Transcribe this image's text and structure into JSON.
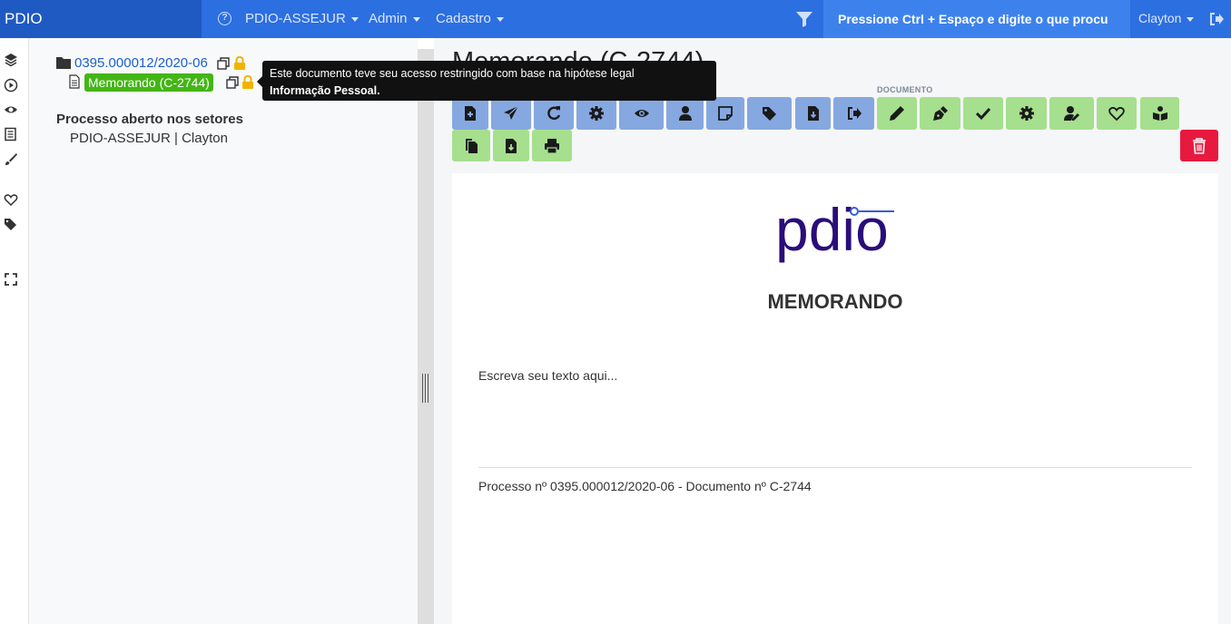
{
  "navbar": {
    "brand": "PDIO",
    "menus": [
      "PDIO-ASSEJUR",
      "Admin",
      "Cadastro"
    ],
    "search_placeholder": "Pressione Ctrl + Espaço e digite o que procu",
    "user": "Clayton"
  },
  "tree": {
    "process_number": "0395.000012/2020-06",
    "document_label": "Memorando (C-2744)",
    "section_title": "Processo aberto nos setores",
    "section_item": "PDIO-ASSEJUR | Clayton"
  },
  "tooltip": {
    "line1": "Este documento teve seu acesso restringido com base na hipótese legal",
    "line2": "Informação Pessoal."
  },
  "main": {
    "title": "Memorando (C-2744)",
    "group_label_document": "DOCUMENTO"
  },
  "document": {
    "logo_text": "pdio",
    "heading": "MEMORANDO",
    "body": "Escreva seu texto aqui...",
    "footer": "Processo nº 0395.000012/2020-06 - Documento nº C-2744"
  },
  "colors": {
    "navbar": "#2c6fe0",
    "brand_bg": "#1f5ac2",
    "process_buttons": "#86a8e0",
    "document_buttons": "#a6df8e",
    "delete_button": "#e8193e",
    "doc_badge": "#44b516",
    "logo": "#2a0d7a"
  },
  "icons": {
    "process_toolbar": [
      "new-document-icon",
      "send-icon",
      "redo-icon",
      "settings-icon",
      "eye-icon",
      "user-icon",
      "note-icon",
      "tags-icon",
      "download-icon",
      "sign-out-icon"
    ],
    "document_toolbar": [
      "pencil-icon",
      "pen-nib-icon",
      "check-icon",
      "settings-icon",
      "user-edit-icon",
      "heart-icon",
      "book-reader-icon",
      "copy-icon",
      "file-download-icon",
      "print-icon"
    ]
  }
}
